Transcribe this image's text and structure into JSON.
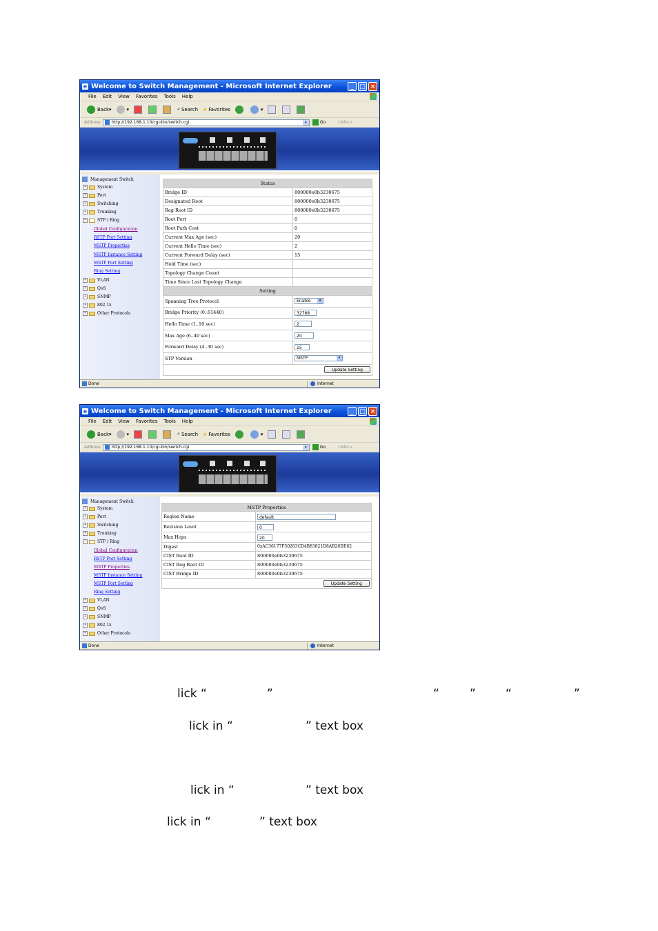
{
  "browser": {
    "title": "Welcome to Switch Management - Microsoft Internet Explorer",
    "menu": [
      "File",
      "Edit",
      "View",
      "Favorites",
      "Tools",
      "Help"
    ],
    "toolbar": {
      "back": "Back",
      "search": "Search",
      "favorites": "Favorites"
    },
    "address_label": "Address",
    "url": "http://192.168.1.10/cgi-bin/switch.cgi",
    "go": "Go",
    "links": "Links",
    "status_left": "Done",
    "status_zone": "Internet"
  },
  "sidebar": {
    "root": "Management Switch",
    "folders_top": [
      "System",
      "Port",
      "Switching",
      "Trunking"
    ],
    "open_folder": "STP / Ring",
    "links": [
      "Global Configuration",
      "RSTP Port Setting",
      "MSTP Properties",
      "MSTP Instance Setting",
      "MSTP Port Setting",
      "Ring Setting"
    ],
    "folders_bottom": [
      "VLAN",
      "QoS",
      "SNMP",
      "802.1x",
      "Other Protocols"
    ]
  },
  "screen1": {
    "status_header": "Status",
    "status_rows": [
      {
        "label": "Bridge ID",
        "value": "800000e0b3230675"
      },
      {
        "label": "Designated Root",
        "value": "800000e0b3230675"
      },
      {
        "label": "Reg Root ID",
        "value": "800000e0b3230675"
      },
      {
        "label": "Root Port",
        "value": "0"
      },
      {
        "label": "Root Path Cost",
        "value": "0"
      },
      {
        "label": "Current Max Age (sec)",
        "value": "20"
      },
      {
        "label": "Current Hello Time (sec)",
        "value": "2"
      },
      {
        "label": "Current Forward Delay (sec)",
        "value": "15"
      },
      {
        "label": "Hold Time (sec)",
        "value": ""
      },
      {
        "label": "Topology Change Count",
        "value": ""
      },
      {
        "label": "Time Since Last Topology Change",
        "value": ""
      }
    ],
    "setting_header": "Setting",
    "setting_rows": {
      "stp": {
        "label": "Spanning Tree Protocol",
        "value": "Enable"
      },
      "priority": {
        "label": "Bridge Priority (0..61440)",
        "value": "32768"
      },
      "hello": {
        "label": "Hello Time (1..10 sec)",
        "value": "2"
      },
      "maxage": {
        "label": "Max Age (6..40 sec)",
        "value": "20"
      },
      "fwd": {
        "label": "Forward Delay (4..30 sec)",
        "value": "15"
      },
      "version": {
        "label": "STP Version",
        "value": "MSTP"
      }
    },
    "update_button": "Update Setting"
  },
  "screen2": {
    "header": "MSTP Properties",
    "region_name": {
      "label": "Region Name",
      "value": "default"
    },
    "revision": {
      "label": "Revision Level",
      "value": "0"
    },
    "max_hops": {
      "label": "Max Hops",
      "value": "20"
    },
    "digest": {
      "label": "Digest",
      "value": "0xAC36177F50283CD4B83821D8AB26DE62"
    },
    "cist_root": {
      "label": "CIST Root ID",
      "value": "800000e0b3230675"
    },
    "cist_reg_root": {
      "label": "CIST Reg Root ID",
      "value": "800000e0b3230675"
    },
    "cist_bridge": {
      "label": "CIST Bridge ID",
      "value": "800000e0b3230675"
    },
    "update_button": "Update Setting"
  },
  "instructions": {
    "line1": [
      "lick “",
      "”",
      "“",
      "”",
      "“",
      "”"
    ],
    "line2": [
      "lick in “",
      "” text box"
    ],
    "line3": [
      "lick in “",
      "” text box"
    ],
    "line4": [
      "lick in “",
      "” text box"
    ]
  }
}
